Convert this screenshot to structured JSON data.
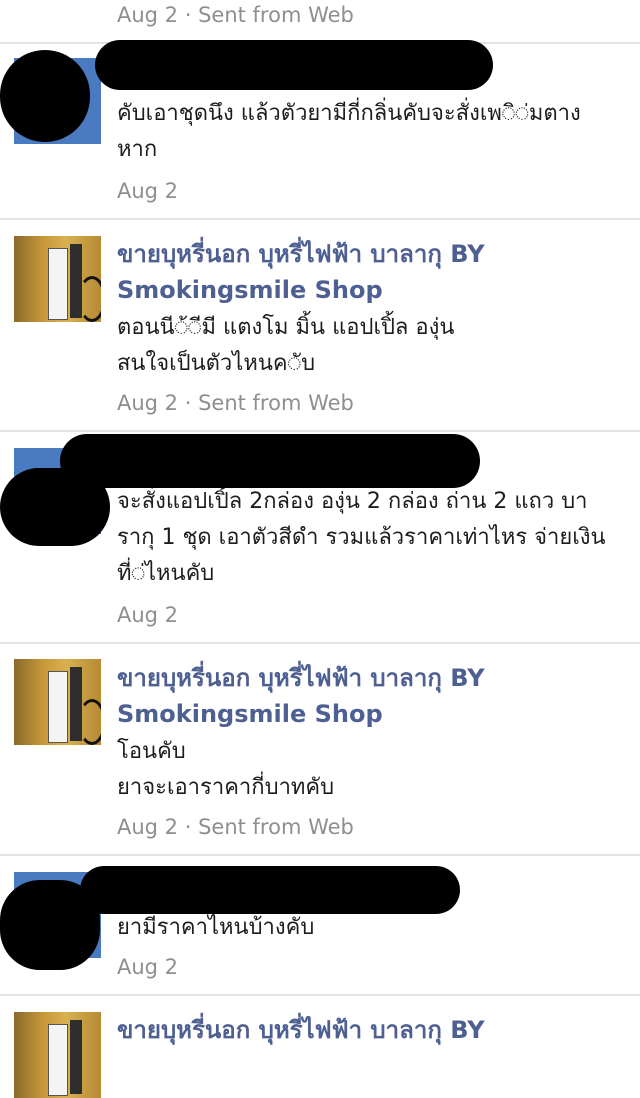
{
  "messages": [
    {
      "meta": "Aug 2 · Sent from Web"
    },
    {
      "text": "คับเอาชุดนึง แล้วตัวยามีกี่กลิ่นคับจะสั่งเพ◌ิ◌่มตาง\nหาก",
      "meta": "Aug 2"
    },
    {
      "sender": "ขายบุหรี่นอก บุหรี่ไฟฟ้า บาลากุ BY Smokingsmile Shop",
      "text": "ตอนนี◌้◌ีมี แตงโม มิ้น แอปเปิ้ล องุ่น\nสนใจเป็นตัวไหนค◌ับ",
      "meta": "Aug 2 · Sent from Web"
    },
    {
      "text": "จะสั่งแอปเปิ้ล 2กล่อง องุ่น 2 กล่อง ถ่าน 2 แถว บา\nรากุ 1 ชุด เอาตัวสีดำ รวมแล้วราคาเท่าไหร จ่ายเงิน\nที่◌่ไหนคับ",
      "meta": "Aug 2"
    },
    {
      "sender": "ขายบุหรี่นอก บุหรี่ไฟฟ้า บาลากุ BY Smokingsmile Shop",
      "text": "โอนคับ\nยาจะเอาราคากี่บาทคับ",
      "meta": "Aug 2 · Sent from Web"
    },
    {
      "text": "ยามีราคาไหนบ้างคับ",
      "meta": "Aug 2"
    },
    {
      "sender": "ขายบุหรี่นอก บุหรี่ไฟฟ้า บาลากุ BY"
    }
  ]
}
